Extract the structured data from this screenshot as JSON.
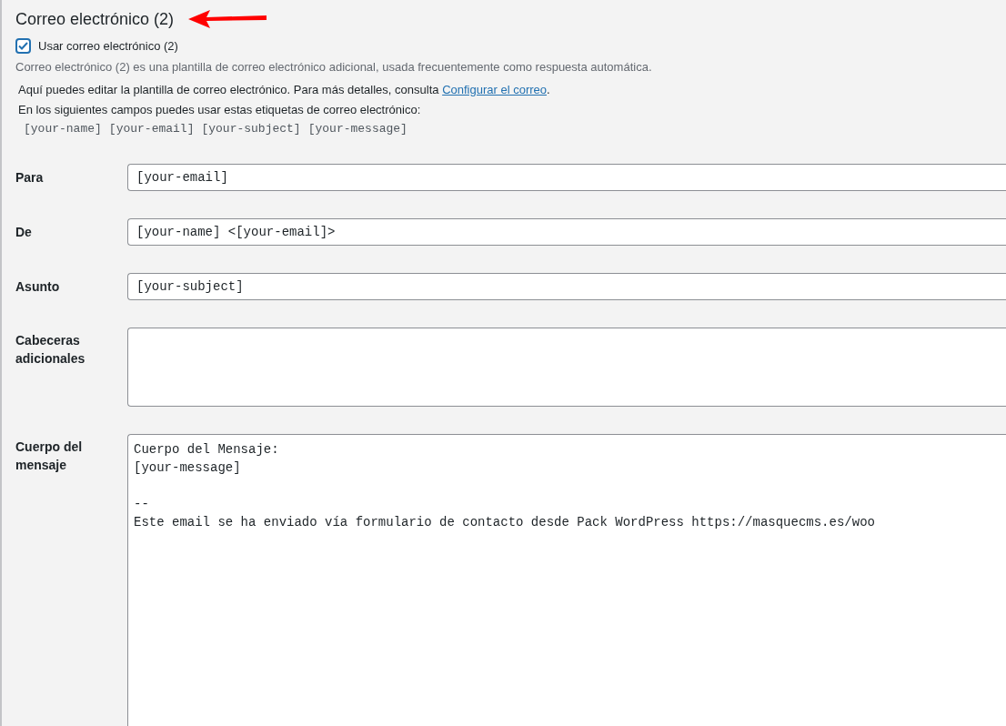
{
  "heading": "Correo electrónico (2)",
  "use_checkbox": {
    "label": "Usar correo electrónico (2)",
    "checked": true
  },
  "description": "Correo electrónico (2) es una plantilla de correo electrónico adicional, usada frecuentemente como respuesta automática.",
  "help": {
    "text": "Aquí puedes editar la plantilla de correo electrónico. Para más detalles, consulta",
    "link": "Configurar el correo",
    "after": "."
  },
  "tags_intro": "En los siguientes campos puedes usar estas etiquetas de correo electrónico:",
  "tags": [
    "[your-name]",
    "[your-email]",
    "[your-subject]",
    "[your-message]"
  ],
  "fields": [
    {
      "label": "Para",
      "kind": "input",
      "value": "[your-email]"
    },
    {
      "label": "De",
      "kind": "input",
      "value": "[your-name] <[your-email]>"
    },
    {
      "label": "Asunto",
      "kind": "input",
      "value": "[your-subject]"
    },
    {
      "label": "Cabeceras adicionales",
      "kind": "textarea"
    },
    {
      "label": "Cuerpo del mensaje",
      "kind": "body",
      "value": "Cuerpo del Mensaje:\n[your-message]\n\n--\nEste email se ha enviado vía formulario de contacto desde Pack WordPress https://masquecms.es/woo"
    }
  ]
}
